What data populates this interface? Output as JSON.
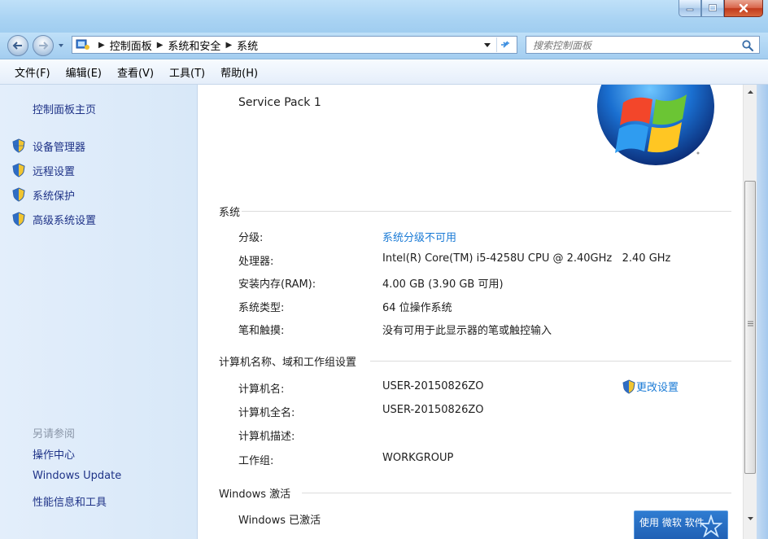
{
  "titlebar": {
    "min_label": "",
    "max_label": "",
    "close_label": ""
  },
  "address": {
    "crumbs": [
      "控制面板",
      "系统和安全",
      "系统"
    ],
    "search_placeholder": "搜索控制面板"
  },
  "menubar": {
    "items": [
      "文件(F)",
      "编辑(E)",
      "查看(V)",
      "工具(T)",
      "帮助(H)"
    ]
  },
  "sidebar": {
    "home": "控制面板主页",
    "tasks": [
      "设备管理器",
      "远程设置",
      "系统保护",
      "高级系统设置"
    ],
    "see_also_title": "另请参阅",
    "see_also": [
      "操作中心",
      "Windows Update",
      "性能信息和工具"
    ]
  },
  "content": {
    "service_pack": "Service Pack 1",
    "system_section": "系统",
    "system_rows": [
      {
        "label": "分级:",
        "value": "系统分级不可用",
        "link": true
      },
      {
        "label": "处理器:",
        "value": "Intel(R) Core(TM) i5-4258U CPU @ 2.40GHz   2.40 GHz"
      },
      {
        "label": "安装内存(RAM):",
        "value": "4.00 GB (3.90 GB 可用)"
      },
      {
        "label": "系统类型:",
        "value": "64 位操作系统"
      },
      {
        "label": "笔和触摸:",
        "value": "没有可用于此显示器的笔或触控输入"
      }
    ],
    "computer_section": "计算机名称、域和工作组设置",
    "computer_rows": [
      {
        "label": "计算机名:",
        "value": "USER-20150826ZO"
      },
      {
        "label": "计算机全名:",
        "value": "USER-20150826ZO"
      },
      {
        "label": "计算机描述:",
        "value": ""
      },
      {
        "label": "工作组:",
        "value": "WORKGROUP"
      }
    ],
    "change_settings": "更改设置",
    "activation_section": "Windows 激活",
    "activation_status": "Windows 已激活",
    "badge_text": "使用 微软 软件"
  },
  "colors": {
    "link": "#1b7bd6",
    "nav_text": "#1e3287",
    "titlebar": "#a9d3f3"
  }
}
